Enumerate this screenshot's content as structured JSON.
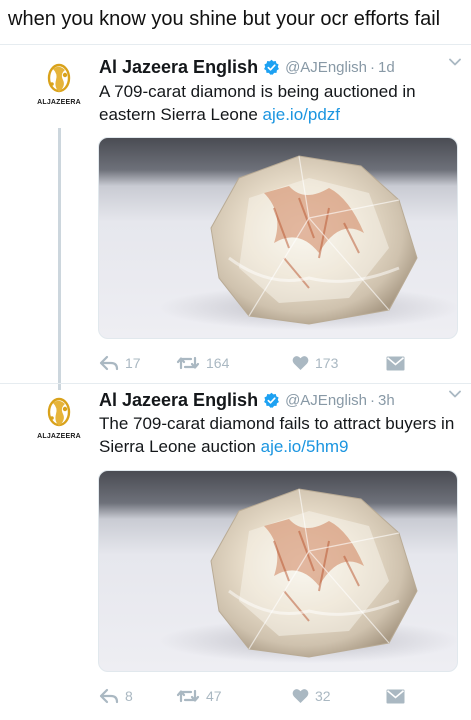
{
  "caption": "when you know you shine but your ocr efforts fail",
  "avatar_text": "ALJAZEERA",
  "colors": {
    "link": "#1b95e0",
    "verified": "#1da1f2",
    "action_gray": "#aab8c2",
    "logo_gold": "#d9a21b"
  },
  "icons": [
    "aljazeera-logo-icon",
    "verified-badge-icon",
    "chevron-down-icon",
    "reply-icon",
    "retweet-icon",
    "heart-icon",
    "direct-message-icon"
  ],
  "tweets": [
    {
      "display_name": "Al Jazeera English",
      "handle": "@AJEnglish",
      "separator": "·",
      "time": "1d",
      "text": "A 709-carat diamond is being auctioned in eastern Sierra Leone",
      "link": "aje.io/pdzf",
      "replies": "17",
      "retweets": "164",
      "likes": "173"
    },
    {
      "display_name": "Al Jazeera English",
      "handle": "@AJEnglish",
      "separator": "·",
      "time": "3h",
      "text": "The 709-carat diamond fails to attract buyers in Sierra Leone auction",
      "link": "aje.io/5hm9",
      "replies": "8",
      "retweets": "47",
      "likes": "32"
    }
  ]
}
